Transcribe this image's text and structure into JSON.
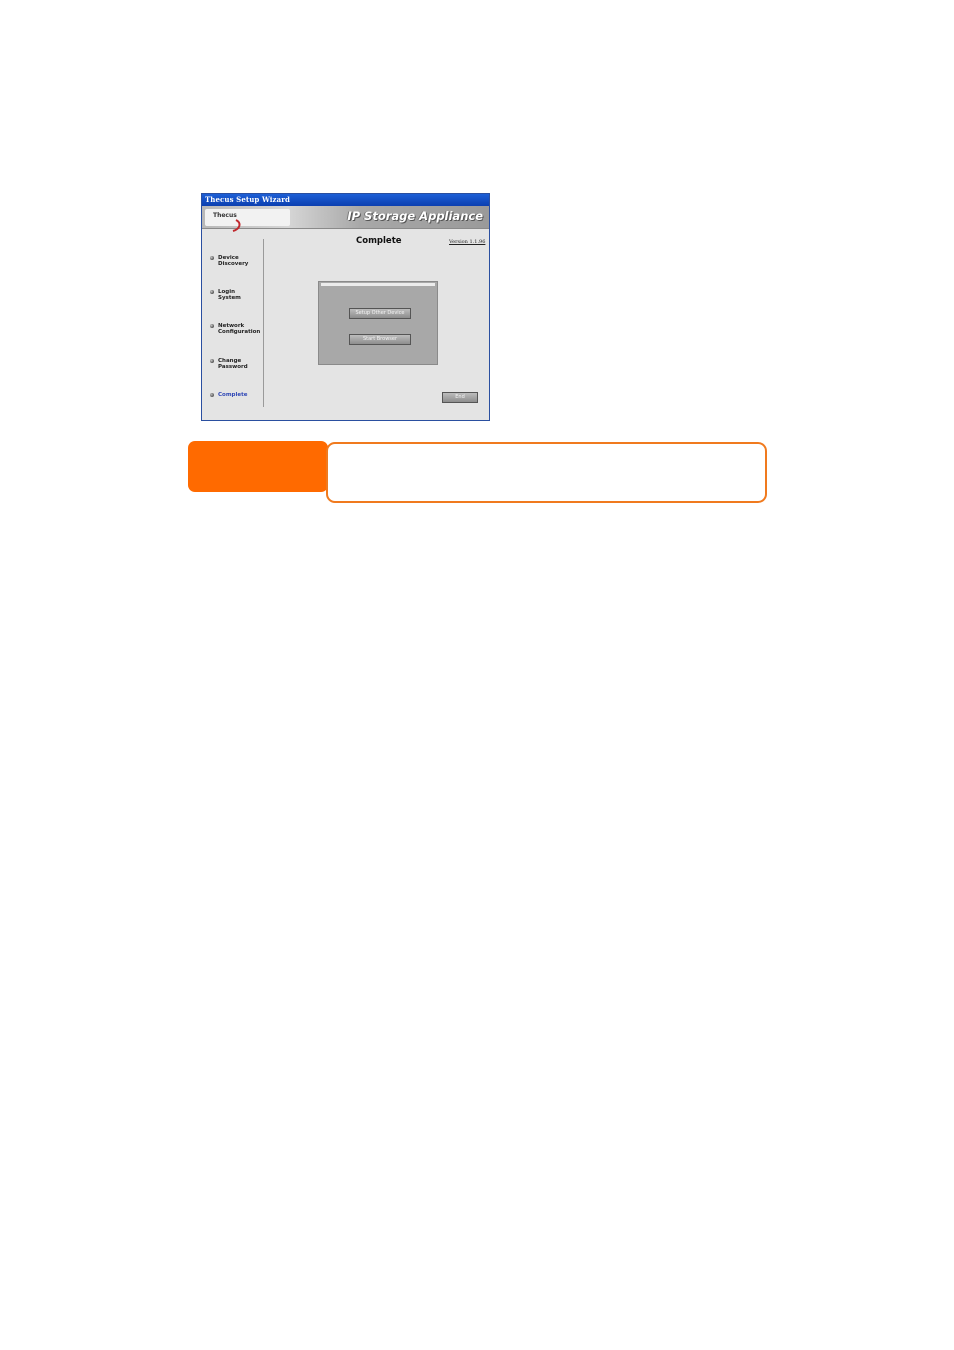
{
  "window": {
    "title": "Thecus Setup Wizard",
    "brand": "Thecus",
    "product": "IP Storage Appliance"
  },
  "sidebar": {
    "items": [
      {
        "label": "Device\nDiscovery"
      },
      {
        "label": "Login\nSystem"
      },
      {
        "label": "Network\nConfiguration"
      },
      {
        "label": "Change\nPassword"
      },
      {
        "label": "Complete",
        "active": true
      }
    ]
  },
  "main": {
    "heading": "Complete",
    "version": "Version 1.1.96",
    "buttons": {
      "setup": "Setup Other Device",
      "browser": "Start Browser",
      "end": "End"
    }
  },
  "colors": {
    "accent": "#ff6a00",
    "title_bar": "#1d5fd6"
  }
}
